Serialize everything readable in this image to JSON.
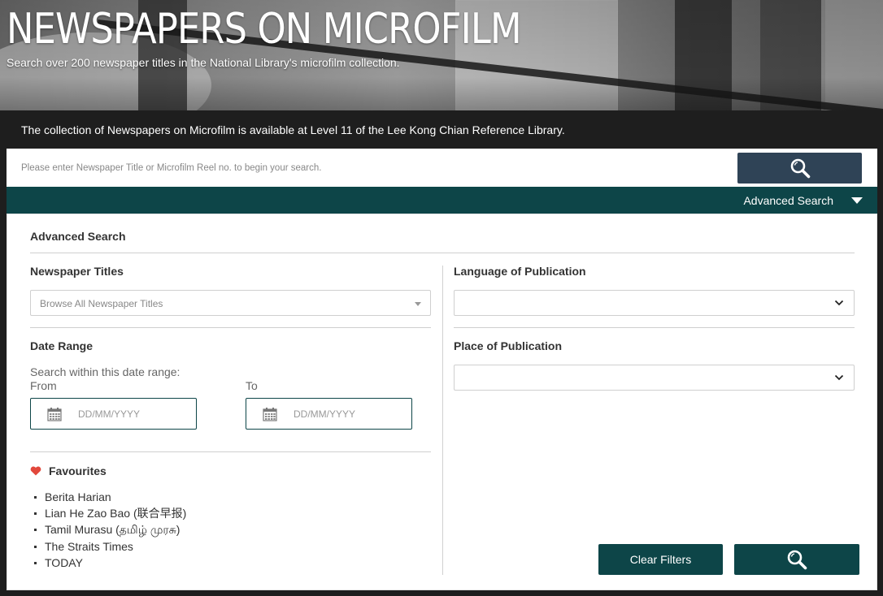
{
  "hero": {
    "title": "NEWSPAPERS ON MICROFILM",
    "subtitle": "Search over 200 newspaper titles in the National Library's microfilm collection."
  },
  "notice": "The collection of Newspapers on Microfilm is available at Level 11 of the Lee Kong Chian Reference Library.",
  "search": {
    "placeholder": "Please enter Newspaper Title or Microfilm Reel no. to begin your search.",
    "button_icon": "search-icon"
  },
  "advanced_toggle": {
    "label": "Advanced Search",
    "icon": "caret-down-icon"
  },
  "advanced": {
    "title": "Advanced Search",
    "newspaper_titles": {
      "label": "Newspaper Titles",
      "placeholder": "Browse All Newspaper Titles"
    },
    "language": {
      "label": "Language of Publication",
      "value": ""
    },
    "place": {
      "label": "Place of Publication",
      "value": ""
    },
    "date_range": {
      "label": "Date Range",
      "hint": "Search within this date range:",
      "from_label": "From",
      "to_label": "To",
      "from_placeholder": "DD/MM/YYYY",
      "to_placeholder": "DD/MM/YYYY",
      "icon": "calendar-icon"
    },
    "favourites": {
      "label": "Favourites",
      "icon": "heart-icon",
      "items": [
        "Berita Harian",
        "Lian He Zao Bao (联合早报)",
        "Tamil Murasu (தமிழ் முரசு)",
        "The Straits Times",
        "TODAY"
      ]
    },
    "clear_label": "Clear Filters",
    "submit_icon": "search-icon"
  },
  "colors": {
    "accent_teal": "#0d4548",
    "search_button": "#2f4356",
    "favourite_heart": "#e2483c"
  }
}
